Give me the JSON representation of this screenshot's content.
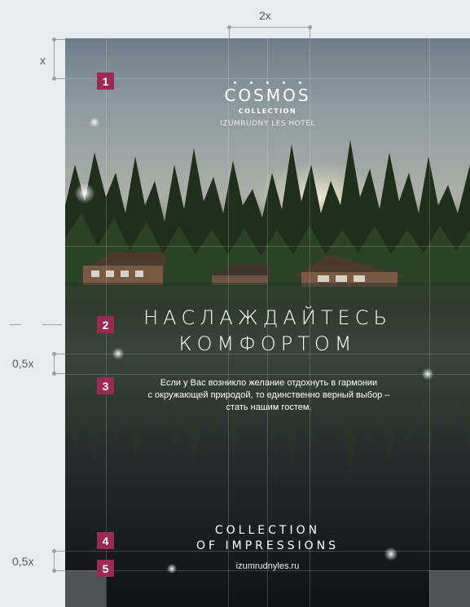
{
  "dimensions": {
    "x_label": "x",
    "two_x_label": "2x",
    "half_x_label_1": "0,5x",
    "half_x_label_2": "0,5x"
  },
  "markers": [
    "1",
    "2",
    "3",
    "4",
    "5"
  ],
  "logo": {
    "brand": "COSMOS",
    "sub": "COLLECTION",
    "hotel": "IZUMRUDNY LES HOTEL"
  },
  "headline": {
    "line1": "НАСЛАЖДАЙТЕСЬ",
    "line2": "КОМФОРТОМ"
  },
  "body": {
    "line1": "Если у Вас возникло желание отдохнуть в гармонии",
    "line2": "с окружающей природой, то единственно верный выбор –",
    "line3": "стать нашим гостем."
  },
  "footer": {
    "line1": "COLLECTION",
    "line2": "OF IMPRESSIONS",
    "url": "izumrudnyles.ru"
  },
  "colors": {
    "marker": "#9b2a52",
    "page_bg": "#e8ecef"
  }
}
